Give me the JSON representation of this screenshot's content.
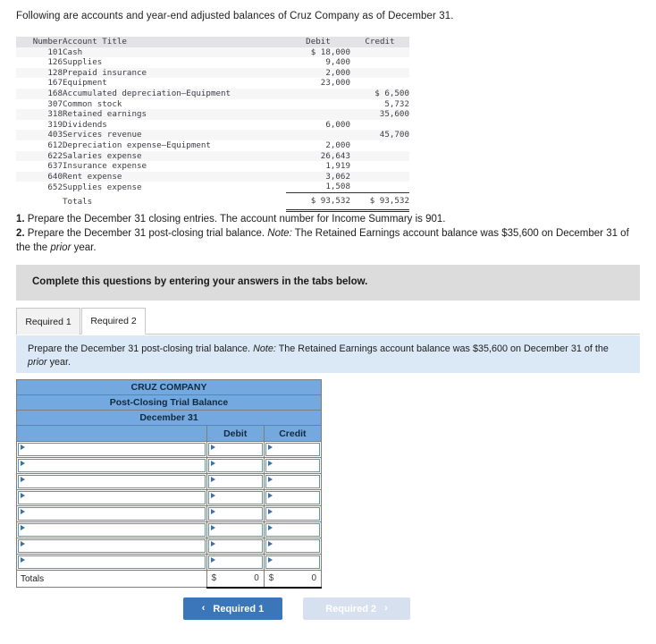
{
  "intro": "Following are accounts and year-end adjusted balances of Cruz Company as of December 31.",
  "trial_balance": {
    "headers": {
      "number": "Number",
      "title": "Account Title",
      "debit": "Debit",
      "credit": "Credit"
    },
    "rows": [
      {
        "number": "101",
        "title": "Cash",
        "debit": "$ 18,000",
        "credit": ""
      },
      {
        "number": "126",
        "title": "Supplies",
        "debit": "9,400",
        "credit": ""
      },
      {
        "number": "128",
        "title": "Prepaid insurance",
        "debit": "2,000",
        "credit": ""
      },
      {
        "number": "167",
        "title": "Equipment",
        "debit": "23,000",
        "credit": ""
      },
      {
        "number": "168",
        "title": "Accumulated depreciation—Equipment",
        "debit": "",
        "credit": "$ 6,500"
      },
      {
        "number": "307",
        "title": "Common stock",
        "debit": "",
        "credit": "5,732"
      },
      {
        "number": "318",
        "title": "Retained earnings",
        "debit": "",
        "credit": "35,600"
      },
      {
        "number": "319",
        "title": "Dividends",
        "debit": "6,000",
        "credit": ""
      },
      {
        "number": "403",
        "title": "Services revenue",
        "debit": "",
        "credit": "45,700"
      },
      {
        "number": "612",
        "title": "Depreciation expense—Equipment",
        "debit": "2,000",
        "credit": ""
      },
      {
        "number": "622",
        "title": "Salaries expense",
        "debit": "26,643",
        "credit": ""
      },
      {
        "number": "637",
        "title": "Insurance expense",
        "debit": "1,919",
        "credit": ""
      },
      {
        "number": "640",
        "title": "Rent expense",
        "debit": "3,062",
        "credit": ""
      },
      {
        "number": "652",
        "title": "Supplies expense",
        "debit": "1,508",
        "credit": ""
      }
    ],
    "totals": {
      "number": "",
      "title": "Totals",
      "debit": "$ 93,532",
      "credit": "$ 93,532"
    }
  },
  "requirements": {
    "item1_num": "1.",
    "item1_text": "Prepare the December 31 closing entries. The account number for Income Summary is 901.",
    "item2_num": "2.",
    "item2_a": "Prepare the December 31 post-closing trial balance.",
    "item2_note": "Note:",
    "item2_b": "The Retained Earnings account balance was $35,600 on December 31 of the",
    "item2_c": "the",
    "item2_italic": "prior",
    "item2_d": "year."
  },
  "banner": {
    "text": "Complete this questions by entering your answers in the tabs below."
  },
  "tabs": [
    {
      "label": "Required 1",
      "active": false
    },
    {
      "label": "Required 2",
      "active": true
    }
  ],
  "instruction_panel": {
    "part1": "Prepare the December 31 post-closing trial balance.",
    "note_label": "Note:",
    "part2": "The Retained Earnings account balance was $35,600 on December",
    "part3": "31 of the",
    "italic": "prior",
    "part4": "year."
  },
  "answer_grid": {
    "company": "CRUZ COMPANY",
    "statement": "Post-Closing Trial Balance",
    "date": "December 31",
    "col_blank": "",
    "col_debit": "Debit",
    "col_credit": "Credit",
    "input_rows": 8,
    "totals_label": "Totals",
    "totals_debit_symbol": "$",
    "totals_debit_value": "0",
    "totals_credit_symbol": "$",
    "totals_credit_value": "0"
  },
  "nav": {
    "prev_label": "Required 1",
    "prev_chevron": "‹",
    "next_label": "Required 2",
    "next_chevron": "›"
  },
  "colors": {
    "header_blue": "#74a9e0",
    "panel_blue": "#dbe9f7",
    "banner_gray": "#dcdcdc",
    "button_blue": "#3a76b8",
    "button_disabled": "#d6e0ef"
  }
}
